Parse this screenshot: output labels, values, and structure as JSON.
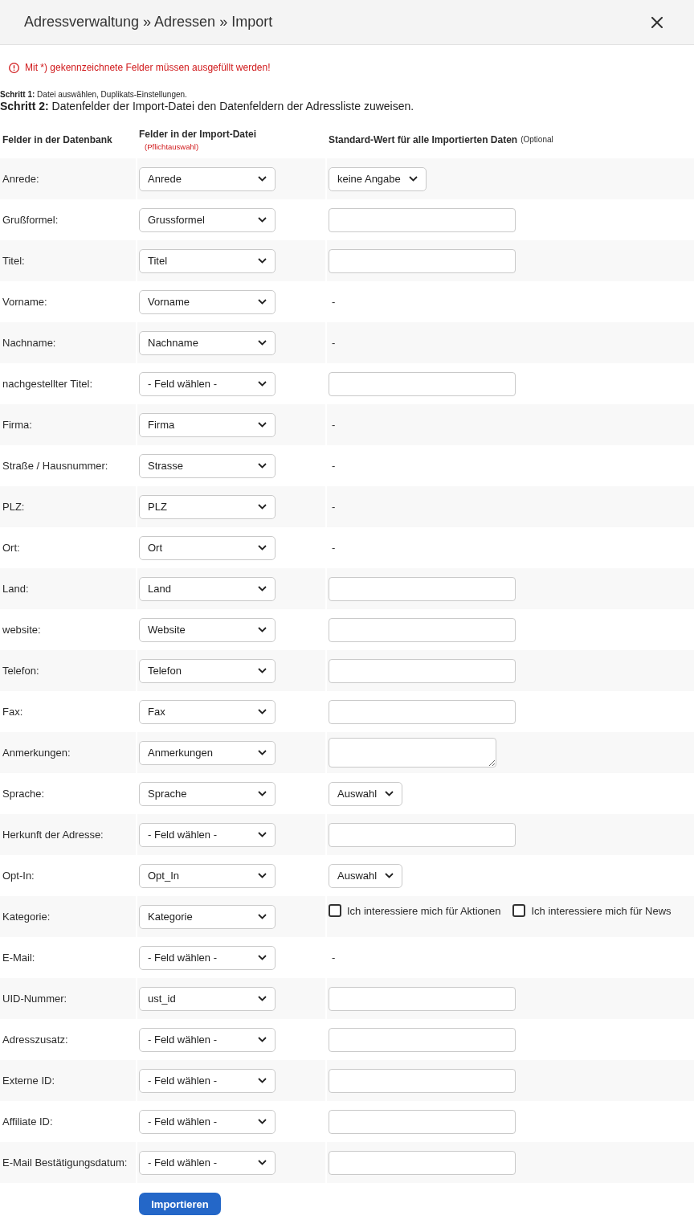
{
  "header": {
    "title": "Adressverwaltung » Adressen » Import"
  },
  "notice": "Mit *) gekennzeichnete Felder müssen ausgefüllt werden!",
  "steps": [
    {
      "text": "**Schritt 1:** Datei auswählen, Duplikats-Einstellungen.",
      "current": false
    },
    {
      "text": "**Schritt 2:** Datenfelder der Import-Datei den Datenfeldern der Adressliste zuweisen.",
      "current": true
    }
  ],
  "table": {
    "columns": [
      {
        "title": "Felder in der Datenbank"
      },
      {
        "title": "Felder in der Import-Datei",
        "note": {
          "text": "(Pflichtauswahl)",
          "kind": "required"
        }
      },
      {
        "title": "Standard-Wert für alle Importierten Daten",
        "note": {
          "text": "(Optional",
          "kind": "optional"
        }
      }
    ],
    "rows": [
      {
        "label": "Anrede:",
        "import_field": "Anrede",
        "default": {
          "kind": "select",
          "value": "keine Angabe"
        }
      },
      {
        "label": "Grußformel:",
        "import_field": "Grussformel",
        "default": {
          "kind": "input"
        }
      },
      {
        "label": "Titel:",
        "import_field": "Titel",
        "default": {
          "kind": "input"
        }
      },
      {
        "label": "Vorname:",
        "import_field": "Vorname",
        "default": {
          "kind": "text",
          "text": "-"
        }
      },
      {
        "label": "Nachname:",
        "import_field": "Nachname",
        "default": {
          "kind": "text",
          "text": "-"
        }
      },
      {
        "label": "nachgestellter Titel:",
        "import_field": "- Feld wählen -",
        "default": {
          "kind": "input"
        }
      },
      {
        "label": "Firma:",
        "import_field": "Firma",
        "default": {
          "kind": "text",
          "text": "-"
        }
      },
      {
        "label": "Straße / Hausnummer:",
        "import_field": "Strasse",
        "default": {
          "kind": "text",
          "text": "-"
        }
      },
      {
        "label": "PLZ:",
        "import_field": "PLZ",
        "default": {
          "kind": "text",
          "text": "-"
        }
      },
      {
        "label": "Ort:",
        "import_field": "Ort",
        "default": {
          "kind": "text",
          "text": "-"
        }
      },
      {
        "label": "Land:",
        "import_field": "Land",
        "default": {
          "kind": "input"
        }
      },
      {
        "label": "website:",
        "import_field": "Website",
        "default": {
          "kind": "input"
        }
      },
      {
        "label": "Telefon:",
        "import_field": "Telefon",
        "default": {
          "kind": "input"
        }
      },
      {
        "label": "Fax:",
        "import_field": "Fax",
        "default": {
          "kind": "input"
        }
      },
      {
        "label": "Anmerkungen:",
        "import_field": "Anmerkungen",
        "default": {
          "kind": "textarea"
        }
      },
      {
        "label": "Sprache:",
        "import_field": "Sprache",
        "default": {
          "kind": "select",
          "value": "Auswahl"
        }
      },
      {
        "label": "Herkunft der Adresse:",
        "import_field": "- Feld wählen -",
        "default": {
          "kind": "input"
        }
      },
      {
        "label": "Opt-In:",
        "import_field": "Opt_In",
        "default": {
          "kind": "select",
          "value": "Auswahl"
        }
      },
      {
        "label": "Kategorie:",
        "import_field": "Kategorie",
        "default": {
          "kind": "checkboxes",
          "options": [
            {
              "label": "Ich interessiere mich für Aktionen",
              "checked": false
            },
            {
              "label": "Ich interessiere mich für News",
              "checked": false
            }
          ]
        }
      },
      {
        "label": "E-Mail:",
        "import_field": "- Feld wählen -",
        "default": {
          "kind": "text",
          "text": "-"
        }
      },
      {
        "label": "UID-Nummer:",
        "import_field": "ust_id",
        "default": {
          "kind": "input"
        }
      },
      {
        "label": "Adresszusatz:",
        "import_field": "- Feld wählen -",
        "default": {
          "kind": "input"
        }
      },
      {
        "label": "Externe ID:",
        "import_field": "- Feld wählen -",
        "default": {
          "kind": "input"
        }
      },
      {
        "label": "Affiliate ID:",
        "import_field": "- Feld wählen -",
        "default": {
          "kind": "input"
        }
      },
      {
        "label": "E-Mail Bestätigungsdatum:",
        "import_field": "- Feld wählen -",
        "default": {
          "kind": "input"
        }
      }
    ]
  },
  "submit": {
    "label": "Importieren"
  }
}
